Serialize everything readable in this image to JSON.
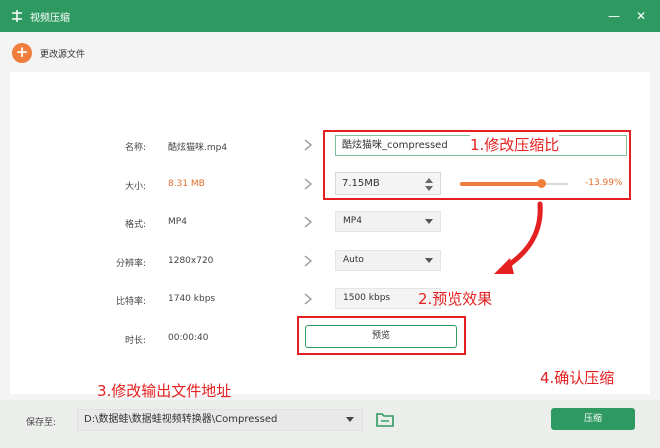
{
  "window": {
    "title": "视频压缩",
    "minimize_glyph": "—",
    "close_glyph": "✕"
  },
  "toolbar": {
    "change_source_label": "更改源文件",
    "plus_glyph": "+"
  },
  "fields": {
    "name": {
      "label": "名称:",
      "value": "酷炫猫咪.mp4",
      "output": "酷炫猫咪_compressed"
    },
    "size": {
      "label": "大小:",
      "value": "8.31 MB",
      "output": "7.15MB",
      "percent": "-13.99%",
      "slider_level": 0.75
    },
    "format": {
      "label": "格式:",
      "value": "MP4",
      "output": "MP4"
    },
    "resolution": {
      "label": "分辨率:",
      "value": "1280x720",
      "output": "Auto"
    },
    "bitrate": {
      "label": "比特率:",
      "value": "1740 kbps",
      "output": "1500 kbps"
    },
    "duration": {
      "label": "时长:",
      "value": "00:00:40"
    }
  },
  "preview_label": "预览",
  "bottom": {
    "save_label": "保存至:",
    "path": "D:\\数据蛙\\数据蛙视频转换器\\Compressed",
    "compress_label": "压缩"
  },
  "annotations": {
    "a1": "1.修改压缩比",
    "a2": "2.预览效果",
    "a3": "3.修改输出文件地址",
    "a4": "4.确认压缩"
  },
  "colors": {
    "brand_green": "#2e9a62",
    "accent_orange": "#ef7d3c",
    "annotation_red": "#e42020"
  }
}
